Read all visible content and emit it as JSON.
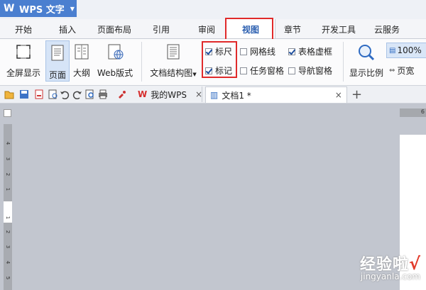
{
  "app": {
    "title": "WPS 文字"
  },
  "menu": {
    "tabs": [
      "开始",
      "插入",
      "页面布局",
      "引用",
      "审阅",
      "视图",
      "章节",
      "开发工具",
      "云服务"
    ],
    "active": "视图"
  },
  "ribbon": {
    "fullscreen": "全屏显示",
    "page": "页面",
    "outline": "大纲",
    "web": "Web版式",
    "docmap": "文档结构图",
    "ruler": "标尺",
    "marks": "标记",
    "grid": "网格线",
    "taskpane": "任务窗格",
    "table_grid": "表格虚框",
    "navpane": "导航窗格",
    "zoom": "显示比例",
    "zoom_value": "100%",
    "page_width": "页宽"
  },
  "checks": {
    "ruler": true,
    "marks": true,
    "grid": false,
    "taskpane": false,
    "table_grid": true,
    "navpane": false
  },
  "doc_tabs": {
    "mywps": "我的WPS",
    "doc1": "文档1 *"
  },
  "ruler": {
    "top_num": "6",
    "v_nums": [
      "4",
      "3",
      "2",
      "1",
      "1",
      "2",
      "3",
      "4",
      "5"
    ]
  },
  "watermark": {
    "main": "经验啦",
    "check": "√",
    "url": "jingyanla.com"
  }
}
